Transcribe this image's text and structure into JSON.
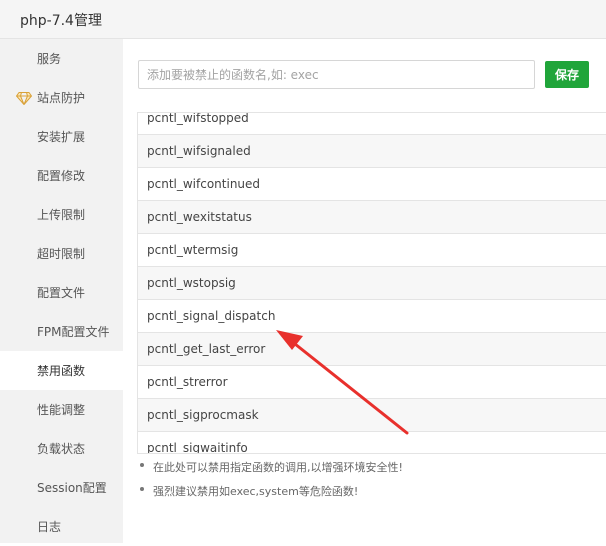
{
  "window": {
    "title": "php-7.4管理"
  },
  "sidebar": {
    "items": [
      {
        "label": "服务",
        "name": "sidebar-item-service",
        "active": false,
        "icon": ""
      },
      {
        "label": "站点防护",
        "name": "sidebar-item-site-protection",
        "active": false,
        "icon": "diamond-icon"
      },
      {
        "label": "安装扩展",
        "name": "sidebar-item-install-extensions",
        "active": false,
        "icon": ""
      },
      {
        "label": "配置修改",
        "name": "sidebar-item-config-modify",
        "active": false,
        "icon": ""
      },
      {
        "label": "上传限制",
        "name": "sidebar-item-upload-limit",
        "active": false,
        "icon": ""
      },
      {
        "label": "超时限制",
        "name": "sidebar-item-timeout-limit",
        "active": false,
        "icon": ""
      },
      {
        "label": "配置文件",
        "name": "sidebar-item-config-file",
        "active": false,
        "icon": ""
      },
      {
        "label": "FPM配置文件",
        "name": "sidebar-item-fpm-config-file",
        "active": false,
        "icon": ""
      },
      {
        "label": "禁用函数",
        "name": "sidebar-item-disabled-functions",
        "active": true,
        "icon": ""
      },
      {
        "label": "性能调整",
        "name": "sidebar-item-performance-tuning",
        "active": false,
        "icon": ""
      },
      {
        "label": "负载状态",
        "name": "sidebar-item-load-status",
        "active": false,
        "icon": ""
      },
      {
        "label": "Session配置",
        "name": "sidebar-item-session-config",
        "active": false,
        "icon": ""
      },
      {
        "label": "日志",
        "name": "sidebar-item-logs",
        "active": false,
        "icon": ""
      }
    ]
  },
  "disabled_functions": {
    "input": {
      "placeholder": "添加要被禁止的函数名,如: exec",
      "value": ""
    },
    "save_label": "保存",
    "functions": [
      "pcntl_wifstopped",
      "pcntl_wifsignaled",
      "pcntl_wifcontinued",
      "pcntl_wexitstatus",
      "pcntl_wtermsig",
      "pcntl_wstopsig",
      "pcntl_signal_dispatch",
      "pcntl_get_last_error",
      "pcntl_strerror",
      "pcntl_sigprocmask",
      "pcntl_sigwaitinfo"
    ],
    "tips": [
      "在此处可以禁用指定函数的调用,以增强环境安全性!",
      "强烈建议禁用如exec,system等危险函数!"
    ]
  },
  "colors": {
    "accent": "#20a53a",
    "annotation": "#e8302c",
    "sidebar_bg": "#f2f2f2",
    "row_alt_bg": "#f7f7f7"
  }
}
